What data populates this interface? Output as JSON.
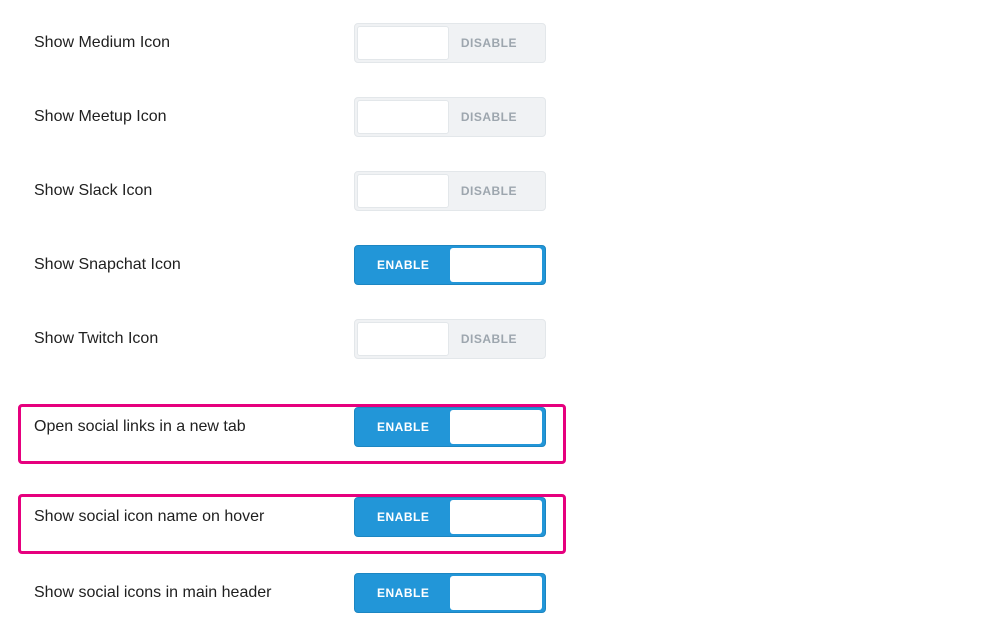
{
  "labels": {
    "enable": "ENABLE",
    "disable": "DISABLE"
  },
  "settings": [
    {
      "id": "medium",
      "label": "Show Medium Icon",
      "enabled": false,
      "highlighted": false
    },
    {
      "id": "meetup",
      "label": "Show Meetup Icon",
      "enabled": false,
      "highlighted": false
    },
    {
      "id": "slack",
      "label": "Show Slack Icon",
      "enabled": false,
      "highlighted": false
    },
    {
      "id": "snapchat",
      "label": "Show Snapchat Icon",
      "enabled": true,
      "highlighted": false
    },
    {
      "id": "twitch",
      "label": "Show Twitch Icon",
      "enabled": false,
      "highlighted": false
    },
    {
      "id": "newtab",
      "label": "Open social links in a new tab",
      "enabled": true,
      "highlighted": true
    },
    {
      "id": "hover",
      "label": "Show social icon name on hover",
      "enabled": true,
      "highlighted": true
    },
    {
      "id": "header",
      "label": "Show social icons in main header",
      "enabled": true,
      "highlighted": false
    }
  ]
}
